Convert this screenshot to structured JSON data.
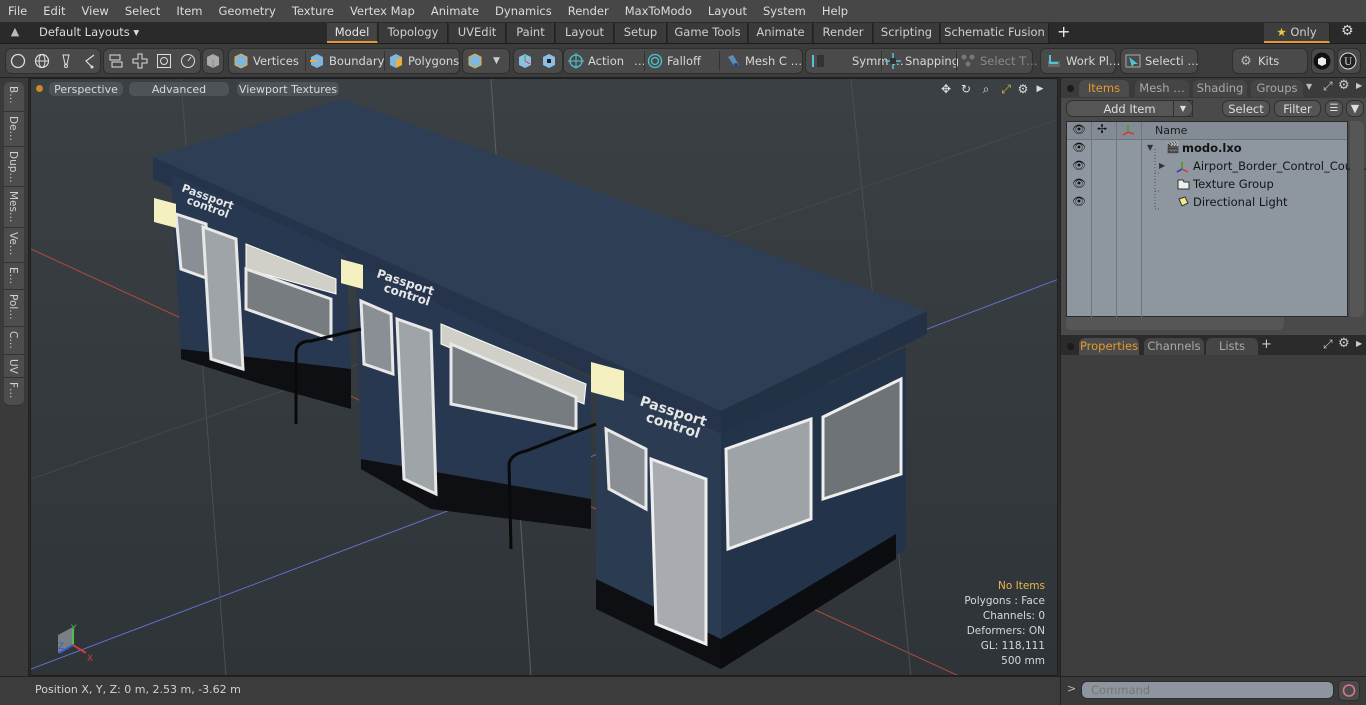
{
  "menubar": {
    "items": [
      "File",
      "Edit",
      "View",
      "Select",
      "Item",
      "Geometry",
      "Texture",
      "Vertex Map",
      "Animate",
      "Dynamics",
      "Render",
      "MaxToModo",
      "Layout",
      "System",
      "Help"
    ]
  },
  "layoutbar": {
    "layouts_label": "Default Layouts ▾",
    "tabs": [
      "Model",
      "Topology",
      "UVEdit",
      "Paint",
      "Layout",
      "Setup",
      "Game Tools",
      "Animate",
      "Render",
      "Scripting",
      "Schematic Fusion"
    ],
    "active_tab": "Model",
    "add_tab": "+",
    "only_label": "Only"
  },
  "toolbar": {
    "vertices": "Vertices",
    "boundary": "Boundary",
    "polygons": "Polygons",
    "action": "Action",
    "action_more": "…",
    "falloff": "Falloff",
    "mesh_c": "Mesh C …",
    "symm": "Symm …",
    "snapping": "Snapping",
    "select_t": "Select T…",
    "work_pl": "Work Pl…",
    "selecti": "Selecti …",
    "kits": "Kits"
  },
  "leftstrip": {
    "tabs": [
      "B…",
      "De…",
      "Dup…",
      "Mes…",
      "Ve…",
      "E…",
      "Pol…",
      "C…",
      "UV",
      "F…"
    ]
  },
  "viewport": {
    "perspective": "Perspective",
    "advanced": "Advanced",
    "textures": "Viewport Textures",
    "info": {
      "no_items": "No Items",
      "polygons": "Polygons : Face",
      "channels": "Channels: 0",
      "deformers": "Deformers: ON",
      "gl": "GL: 118,111",
      "scale": "500 mm"
    },
    "sign_text_1": "Passport",
    "sign_text_2": "control",
    "axis": {
      "x": "X",
      "y": "Y",
      "z": "Z"
    }
  },
  "statusbar": {
    "position": "Position X, Y, Z:   0 m, 2.53 m, -3.62 m"
  },
  "items_panel": {
    "tabs": [
      "Items",
      "Mesh …",
      "Shading",
      "Groups"
    ],
    "active_tab": "Items",
    "add_item": "Add Item",
    "select": "Select",
    "filter": "Filter",
    "name_header": "Name",
    "rows": [
      {
        "name": "modo.lxo",
        "icon": "scene-icon",
        "bold": true
      },
      {
        "name": "Airport_Border_Control_Cou …",
        "icon": "mesh-locator-icon",
        "bold": false
      },
      {
        "name": "Texture Group",
        "icon": "texture-group-icon",
        "bold": false
      },
      {
        "name": "Directional Light",
        "icon": "light-icon",
        "bold": false
      }
    ]
  },
  "properties_panel": {
    "tabs": [
      "Properties",
      "Channels",
      "Lists"
    ],
    "active_tab": "Properties",
    "add_tab": "+"
  },
  "command": {
    "prompt": ">",
    "placeholder": "Command"
  },
  "colors": {
    "accent": "#e39b2f",
    "viewport_bg": "#333a3e",
    "booth_blue": "#2c3c52",
    "list_bg": "#8e979f"
  }
}
